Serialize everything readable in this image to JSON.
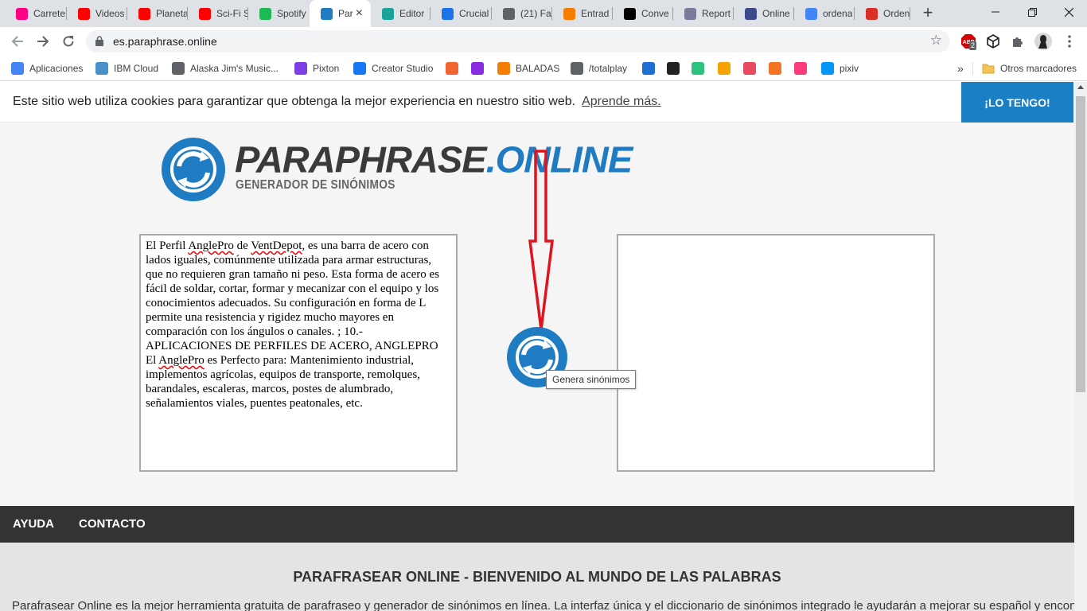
{
  "tabs": [
    {
      "label": "Carrete",
      "icon": "flickr-icon",
      "color": "#ff0084"
    },
    {
      "label": "Videos",
      "icon": "youtube-icon",
      "color": "#ff0000"
    },
    {
      "label": "Planeta",
      "icon": "youtube-icon",
      "color": "#ff0000"
    },
    {
      "label": "Sci-Fi S",
      "icon": "youtube-icon",
      "color": "#ff0000"
    },
    {
      "label": "Spotify",
      "icon": "spotify-icon",
      "color": "#1db954"
    },
    {
      "label": "Par",
      "icon": "paraphrase-icon",
      "color": "#1f7cc2"
    },
    {
      "label": "Editor",
      "icon": "editor-icon",
      "color": "#1aa39b"
    },
    {
      "label": "Crucial",
      "icon": "c-icon",
      "color": "#1a73e8"
    },
    {
      "label": "(21) Fa",
      "icon": "circle-arrow-icon",
      "color": "#5f6368"
    },
    {
      "label": "Entrad",
      "icon": "blogger-icon",
      "color": "#f57d00"
    },
    {
      "label": "Conve",
      "icon": "j-icon",
      "color": "#000000"
    },
    {
      "label": "Report",
      "icon": "report-icon",
      "color": "#7a7a9a"
    },
    {
      "label": "Online",
      "icon": "film-icon",
      "color": "#3a4a8a"
    },
    {
      "label": "ordena",
      "icon": "google-icon",
      "color": "#4285f4"
    },
    {
      "label": "Orden",
      "icon": "tree-icon",
      "color": "#d93025"
    }
  ],
  "toolbar": {
    "url": "es.paraphrase.online",
    "adblock_badge": "2"
  },
  "bookmarks": [
    {
      "label": "Aplicaciones",
      "icon": "apps-grid-icon",
      "color": "#4285f4"
    },
    {
      "label": "IBM Cloud",
      "icon": "cloud-icon",
      "color": "#4a90c8"
    },
    {
      "label": "Alaska Jim's Music...",
      "icon": "globe-icon",
      "color": "#5f6368"
    },
    {
      "label": "Pixton",
      "icon": "pixton-icon",
      "color": "#7b3fe4"
    },
    {
      "label": "Creator Studio",
      "icon": "facebook-icon",
      "color": "#1877f2"
    },
    {
      "label": "",
      "icon": "pinwheel-icon",
      "color": "#f0652f"
    },
    {
      "label": "",
      "icon": "m-icon",
      "color": "#8a2be2"
    },
    {
      "label": "BALADAS",
      "icon": "blogger-icon",
      "color": "#f57d00"
    },
    {
      "label": "/totalplay",
      "icon": "globe-icon",
      "color": "#5f6368"
    },
    {
      "label": "",
      "icon": "x-icon",
      "color": "#1d6fd1"
    },
    {
      "label": "",
      "icon": "bars-icon",
      "color": "#222222"
    },
    {
      "label": "",
      "icon": "star-square-icon",
      "color": "#2ec27e"
    },
    {
      "label": "",
      "icon": "blogger-icon",
      "color": "#f5a300"
    },
    {
      "label": "",
      "icon": "dots-icon",
      "color": "#e84a5f"
    },
    {
      "label": "",
      "icon": "crunchyroll-icon",
      "color": "#f47521"
    },
    {
      "label": "",
      "icon": "heart-icon",
      "color": "#ff3b7f"
    },
    {
      "label": "pixiv",
      "icon": "pixiv-icon",
      "color": "#0096fa"
    }
  ],
  "bookmarks_more": "»",
  "other_bookmarks": "Otros marcadores",
  "cookie": {
    "text": "Este sitio web utiliza cookies para garantizar que obtenga la mejor experiencia en nuestro sitio web.",
    "link": "Aprende más.",
    "button": "¡LO TENGO!"
  },
  "logo": {
    "title_main": "PARAPHRASE",
    "title_accent": ".ONLINE",
    "subtitle": "GENERADOR DE SINÓNIMOS"
  },
  "input_text": [
    {
      "t": "El Perfil "
    },
    {
      "t": "AnglePro",
      "s": true
    },
    {
      "t": " de "
    },
    {
      "t": "VentDepot",
      "s": true
    },
    {
      "t": ", es una barra de acero con lados iguales, comúnmente utilizada para armar estructuras, que no requieren gran tamaño ni peso. Esta forma de acero es fácil de soldar, cortar, formar y mecanizar con el equipo y los conocimientos adecuados. Su configuración en forma de L permite una resistencia y rigidez mucho mayores en comparación con los ángulos o canales. ; 10.- APLICACIONES DE PERFILES DE ACERO, ANGLEPRO El "
    },
    {
      "t": "AnglePro",
      "s": true
    },
    {
      "t": " es Perfecto para: Mantenimiento industrial, implementos agrícolas, equipos de transporte, remolques, barandales, escaleras, marcos, postes de alumbrado, señalamientos viales, puentes peatonales, etc."
    }
  ],
  "output_text": "",
  "generate_tooltip": "Genera sinónimos",
  "footer_nav": {
    "help": "AYUDA",
    "contact": "CONTACTO"
  },
  "info": {
    "title": "PARAFRASEAR ONLINE - BIENVENIDO AL MUNDO DE LAS PALABRAS",
    "text": "Parafrasear Online es la mejor herramienta gratuita de parafraseo y generador de sinónimos en línea. La interfaz única y el diccionario de sinónimos integrado le ayudarán a mejorar su español y encontrar"
  },
  "colors": {
    "brand_blue": "#1f7cc2",
    "annotation_red": "#e0141e",
    "footer_dark": "#333333"
  }
}
